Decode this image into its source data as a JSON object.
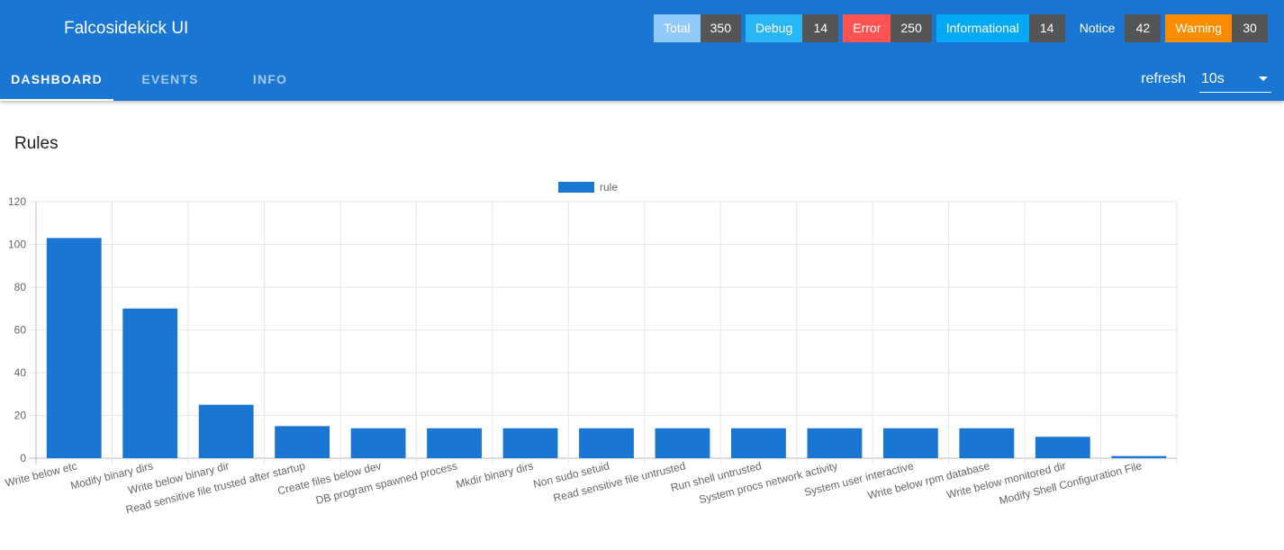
{
  "header": {
    "title": "Falcosidekick UI",
    "badges": [
      {
        "label": "Total",
        "count": "350",
        "color": "#90caf9"
      },
      {
        "label": "Debug",
        "count": "14",
        "color": "#29b6f6"
      },
      {
        "label": "Error",
        "count": "250",
        "color": "#ff5252"
      },
      {
        "label": "Informational",
        "count": "14",
        "color": "#03a9f4"
      },
      {
        "label": "Notice",
        "count": "42",
        "color": "#1976d2"
      },
      {
        "label": "Warning",
        "count": "30",
        "color": "#fb8c00"
      }
    ]
  },
  "tabs": [
    {
      "label": "DASHBOARD",
      "active": true
    },
    {
      "label": "EVENTS",
      "active": false
    },
    {
      "label": "INFO",
      "active": false
    }
  ],
  "refresh": {
    "label": "refresh",
    "value": "10s"
  },
  "section": {
    "title": "Rules"
  },
  "chart_data": {
    "type": "bar",
    "categories": [
      "Write below etc",
      "Modify binary dirs",
      "Write below binary dir",
      "Read sensitive file trusted after startup",
      "Create files below dev",
      "DB program spawned process",
      "Mkdir binary dirs",
      "Non sudo setuid",
      "Read sensitive file untrusted",
      "Run shell untrusted",
      "System procs network activity",
      "System user interactive",
      "Write below rpm database",
      "Write below monitored dir",
      "Modify Shell Configuration File"
    ],
    "series": [
      {
        "name": "rule",
        "values": [
          103,
          70,
          25,
          15,
          14,
          14,
          14,
          14,
          14,
          14,
          14,
          14,
          14,
          10,
          1
        ],
        "color": "#1976d2"
      }
    ],
    "ylim": [
      0,
      120
    ],
    "yticks": [
      0,
      20,
      40,
      60,
      80,
      100,
      120
    ],
    "grid": true,
    "legend": "top-center"
  }
}
